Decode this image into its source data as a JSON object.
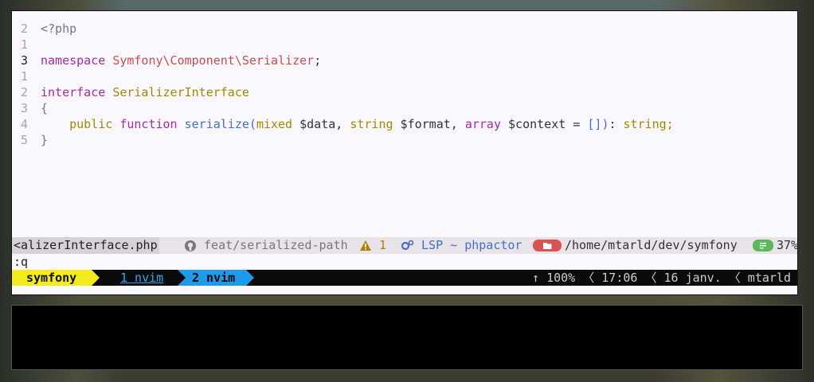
{
  "editor": {
    "lines": [
      {
        "num": "2",
        "tokens": [
          {
            "t": "<?php",
            "c": "tag"
          }
        ]
      },
      {
        "num": "1",
        "tokens": []
      },
      {
        "num": "3",
        "current": true,
        "tokens": [
          {
            "t": "namespace",
            "c": "kw"
          },
          {
            "t": " ",
            "c": "pl"
          },
          {
            "t": "Symfony\\Component\\Serializer",
            "c": "ns"
          },
          {
            "t": ";",
            "c": "pl"
          }
        ]
      },
      {
        "num": "1",
        "tokens": []
      },
      {
        "num": "2",
        "tokens": [
          {
            "t": "interface",
            "c": "kw"
          },
          {
            "t": " ",
            "c": "pl"
          },
          {
            "t": "SerializerInterface",
            "c": "type"
          }
        ]
      },
      {
        "num": "3",
        "tokens": [
          {
            "t": "{",
            "c": "brace"
          }
        ]
      },
      {
        "num": "4",
        "tokens": [
          {
            "t": "    ",
            "c": "pl"
          },
          {
            "t": "public",
            "c": "type"
          },
          {
            "t": " ",
            "c": "pl"
          },
          {
            "t": "function",
            "c": "kw"
          },
          {
            "t": " ",
            "c": "pl"
          },
          {
            "t": "serialize",
            "c": "fn"
          },
          {
            "t": "(",
            "c": "br"
          },
          {
            "t": "mixed",
            "c": "type"
          },
          {
            "t": " $data, ",
            "c": "var"
          },
          {
            "t": "string",
            "c": "type"
          },
          {
            "t": " $format, ",
            "c": "var"
          },
          {
            "t": "array",
            "c": "kw"
          },
          {
            "t": " $context = ",
            "c": "var"
          },
          {
            "t": "[]",
            "c": "br"
          },
          {
            "t": ")",
            "c": "br"
          },
          {
            "t": ": ",
            "c": "pl"
          },
          {
            "t": "string",
            "c": "type"
          },
          {
            "t": ";",
            "c": "type"
          }
        ]
      },
      {
        "num": "5",
        "tokens": [
          {
            "t": "}",
            "c": "brace"
          }
        ]
      }
    ]
  },
  "statusline": {
    "file": "<alizerInterface.php",
    "branch_icon": "github-icon",
    "branch": "feat/serialized-path",
    "warning_icon": "warning-icon",
    "warning_count": "1",
    "lsp_icon": "gears-icon",
    "lsp": "LSP ~ phpactor",
    "dir_icon": "folder-icon",
    "dir": "/home/mtarld/dev/symfony",
    "pct_icon": "lines-icon",
    "pct": "37%"
  },
  "cmdline": ":q",
  "tmux": {
    "session": "symfony",
    "window1": "1 nvim",
    "window2": "2 nvim",
    "right": "↑ 100% 〈 17:06 〈 16 janv. 〈 mtarld"
  },
  "colors": {
    "session_bg": "#f4ea1c",
    "active_window_bg": "#1e9ae8",
    "folder_badge": "#d9534f",
    "pct_badge": "#5cb85c"
  }
}
